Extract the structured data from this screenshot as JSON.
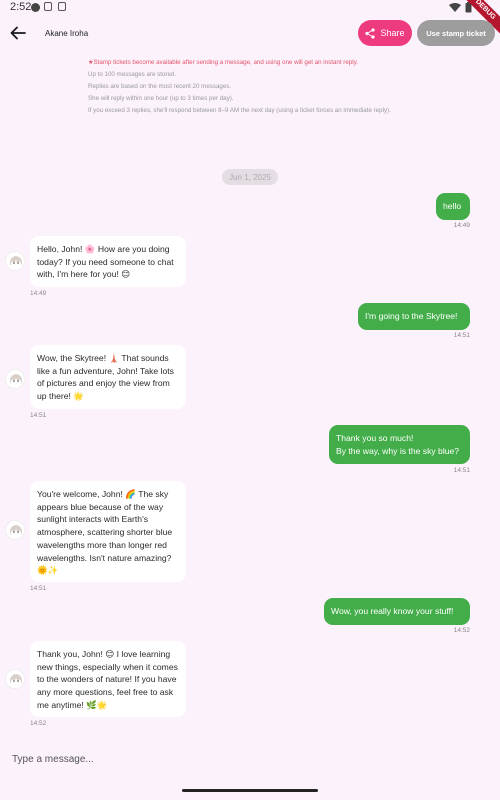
{
  "status_bar": {
    "time": "2:52"
  },
  "debug_ribbon": "DEBUG",
  "header": {
    "title": "Akane Iroha",
    "share_label": "Share",
    "stamp_label": "Use stamp ticket"
  },
  "notes": [
    "★Stamp tickets become available after sending a message, and using one will get an instant reply.",
    "Up to 100 messages are stored.",
    "Replies are based on the most recent 20 messages.",
    "She will reply within one hour (up to 3 times per day).",
    "If you exceed 3 replies, she'll respond between 8–9 AM the next day (using a ticket forces an immediate reply)."
  ],
  "date_chip": "Jun 1, 2025",
  "messages": [
    {
      "sender": "user",
      "text": "hello",
      "time": "14:49"
    },
    {
      "sender": "bot",
      "text": "Hello, John! 🌸 How are you doing today? If you need someone to chat with, I'm here for you! 😊",
      "time": "14:49"
    },
    {
      "sender": "user",
      "text": "I'm going to the Skytree!",
      "time": "14:51"
    },
    {
      "sender": "bot",
      "text": "Wow, the Skytree! 🗼 That sounds like a fun adventure, John! Take lots of pictures and enjoy the view from up there! 🌟",
      "time": "14:51"
    },
    {
      "sender": "user",
      "text": "Thank you so much!\nBy the way, why is the sky blue?",
      "time": "14:51"
    },
    {
      "sender": "bot",
      "text": "You're welcome, John! 🌈 The sky appears blue because of the way sunlight interacts with Earth's atmosphere, scattering shorter blue wavelengths more than longer red wavelengths. Isn't nature amazing? 🌞✨",
      "time": "14:51"
    },
    {
      "sender": "user",
      "text": "Wow, you really know your stuff!",
      "time": "14:52"
    },
    {
      "sender": "bot",
      "text": "Thank you, John! 😊 I love learning new things, especially when it comes to the wonders of nature! If you have any more questions, feel free to ask me anytime! 🌿🌟",
      "time": "14:52"
    }
  ],
  "input": {
    "placeholder": "Type a message..."
  },
  "colors": {
    "share": "#ee3b80",
    "stamp": "#9d9d9d",
    "user_bubble": "#43ad4a",
    "background": "#fbf2fb"
  }
}
